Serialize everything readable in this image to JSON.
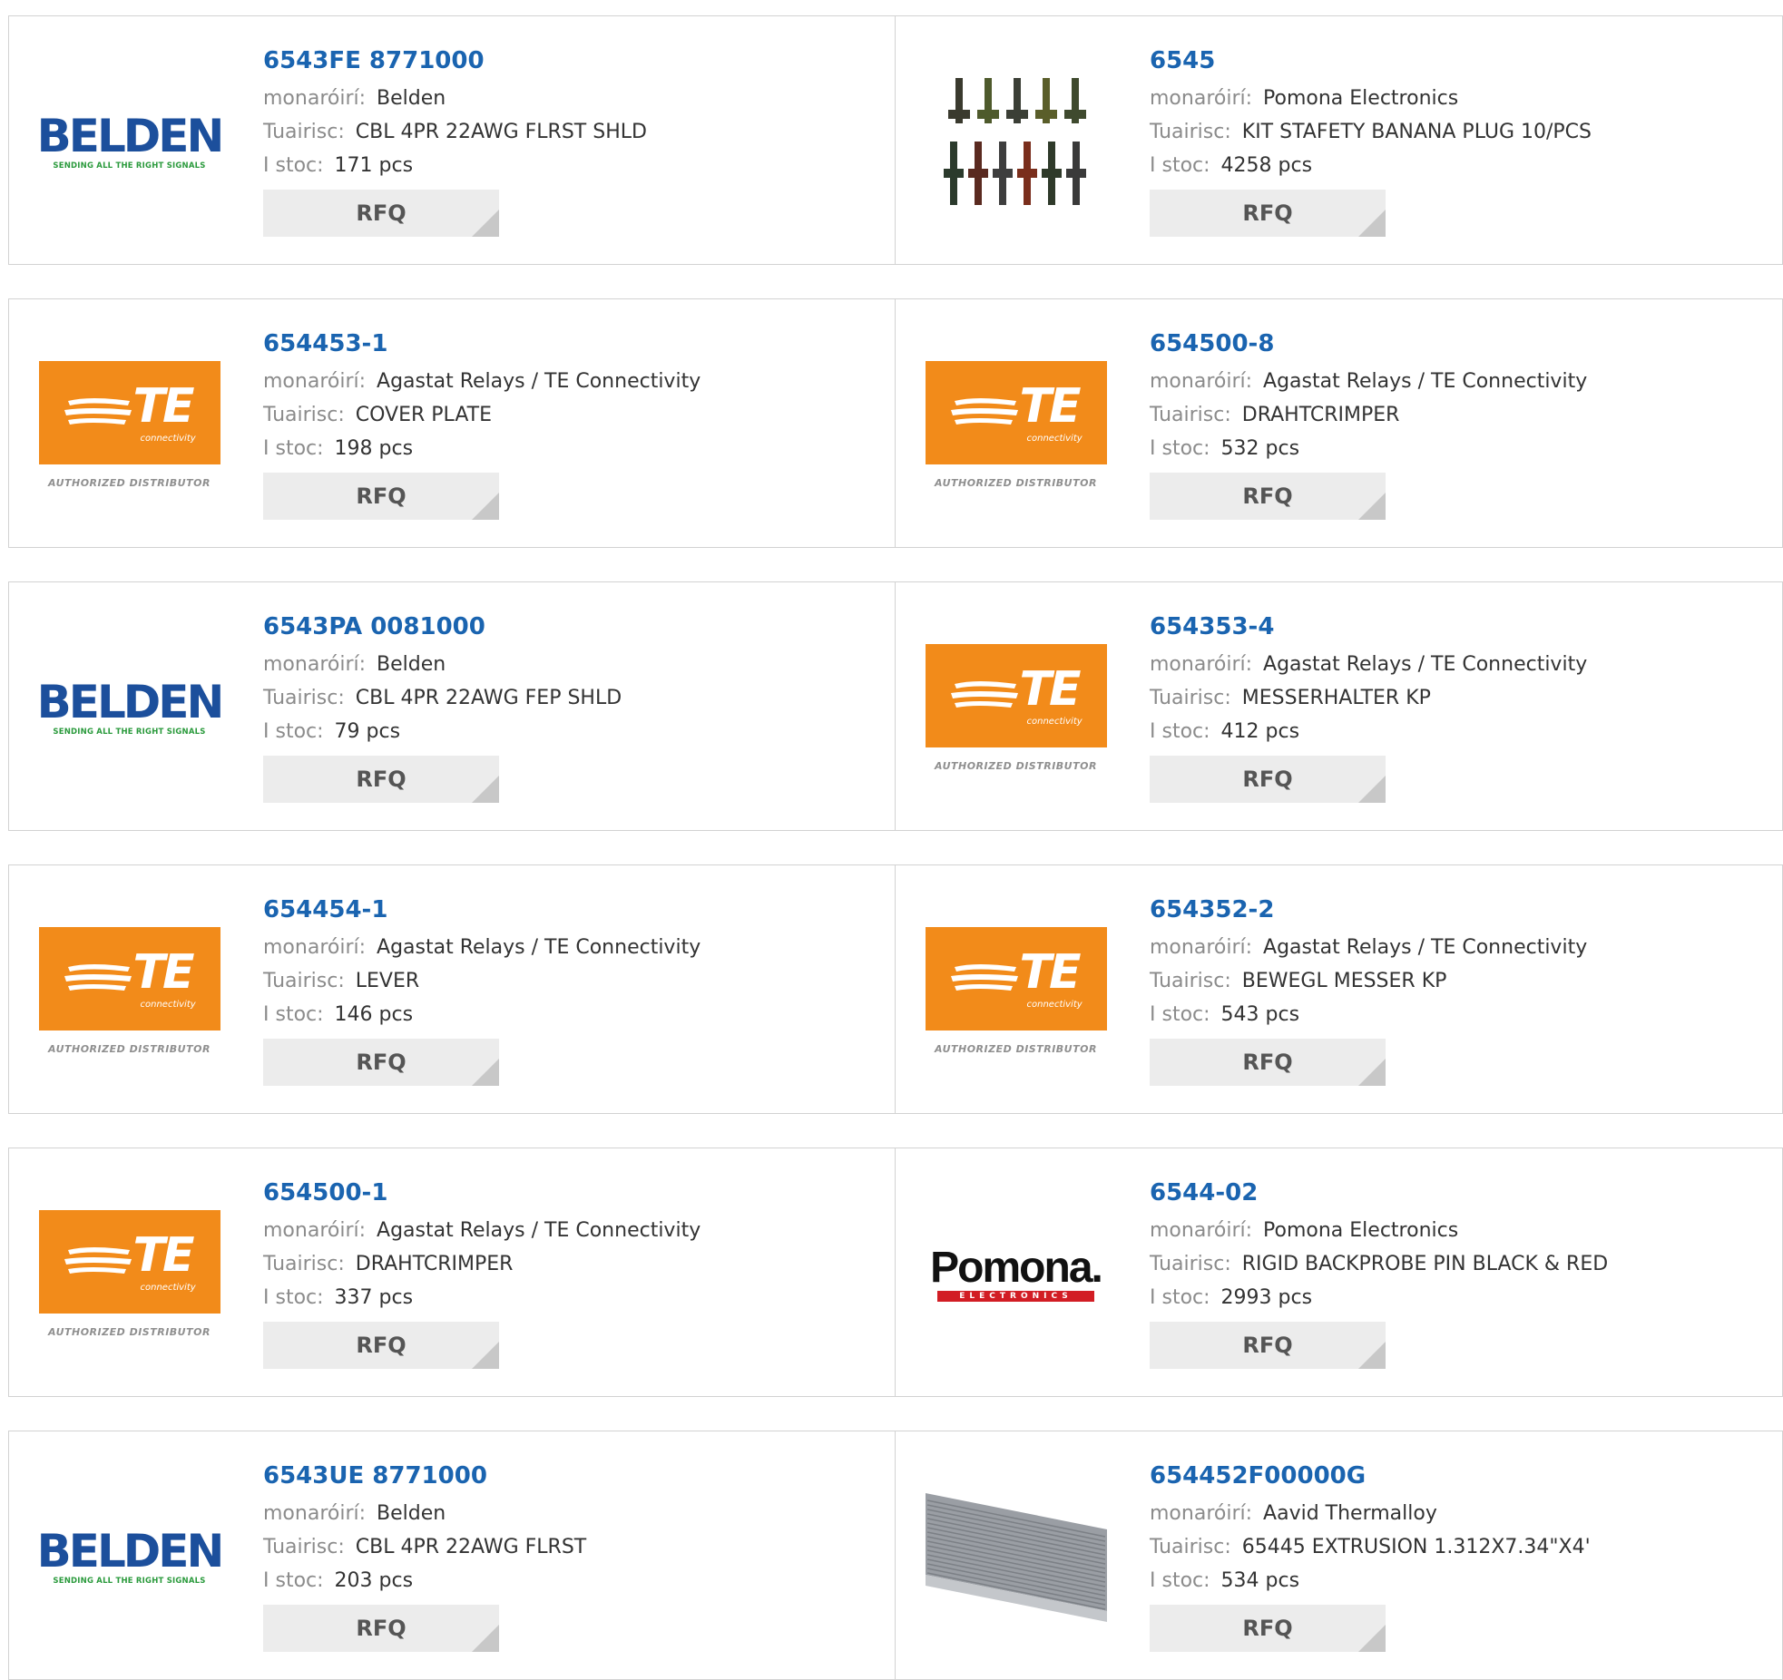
{
  "labels": {
    "manufacturer": "monaróirí:",
    "description": "Tuairisc:",
    "stock": "I stoc:",
    "rfq": "RFQ"
  },
  "logo_text": {
    "belden_word": "BELDEN",
    "belden_tag": "SENDING ALL THE RIGHT SIGNALS",
    "te_word": "TE",
    "te_sub": "connectivity",
    "te_auth": "AUTHORIZED DISTRIBUTOR",
    "pomona_word": "Pomona.",
    "pomona_sub": "ELECTRONICS"
  },
  "products": [
    {
      "pn": "6543FE 8771000",
      "mfr": "Belden",
      "desc": "CBL 4PR 22AWG FLRST SHLD",
      "stock": "171 pcs",
      "logo": "belden"
    },
    {
      "pn": "6545",
      "mfr": "Pomona Electronics",
      "desc": "KIT STAFETY BANANA PLUG 10/PCS",
      "stock": "4258 pcs",
      "logo": "plugs"
    },
    {
      "pn": "654453-1",
      "mfr": "Agastat Relays / TE Connectivity",
      "desc": "COVER PLATE",
      "stock": "198 pcs",
      "logo": "te"
    },
    {
      "pn": "654500-8",
      "mfr": "Agastat Relays / TE Connectivity",
      "desc": "DRAHTCRIMPER",
      "stock": "532 pcs",
      "logo": "te"
    },
    {
      "pn": "6543PA 0081000",
      "mfr": "Belden",
      "desc": "CBL 4PR 22AWG FEP SHLD",
      "stock": "79 pcs",
      "logo": "belden"
    },
    {
      "pn": "654353-4",
      "mfr": "Agastat Relays / TE Connectivity",
      "desc": "MESSERHALTER KP",
      "stock": "412 pcs",
      "logo": "te"
    },
    {
      "pn": "654454-1",
      "mfr": "Agastat Relays / TE Connectivity",
      "desc": "LEVER",
      "stock": "146 pcs",
      "logo": "te"
    },
    {
      "pn": "654352-2",
      "mfr": "Agastat Relays / TE Connectivity",
      "desc": "BEWEGL MESSER KP",
      "stock": "543 pcs",
      "logo": "te"
    },
    {
      "pn": "654500-1",
      "mfr": "Agastat Relays / TE Connectivity",
      "desc": "DRAHTCRIMPER",
      "stock": "337 pcs",
      "logo": "te"
    },
    {
      "pn": "6544-02",
      "mfr": "Pomona Electronics",
      "desc": "RIGID BACKPROBE PIN BLACK & RED",
      "stock": "2993 pcs",
      "logo": "pomona"
    },
    {
      "pn": "6543UE 8771000",
      "mfr": "Belden",
      "desc": "CBL 4PR 22AWG FLRST",
      "stock": "203 pcs",
      "logo": "belden"
    },
    {
      "pn": "654452F00000G",
      "mfr": "Aavid Thermalloy",
      "desc": "65445 EXTRUSION 1.312X7.34\"X4'",
      "stock": "534 pcs",
      "logo": "extrusion"
    }
  ],
  "colors": {
    "part_number": "#1a64b0",
    "label": "#8b8b8b",
    "rfq_bg": "#ececec",
    "te_orange": "#f28b1a",
    "belden_blue": "#1c4f9c",
    "pomona_red": "#d21d24"
  }
}
